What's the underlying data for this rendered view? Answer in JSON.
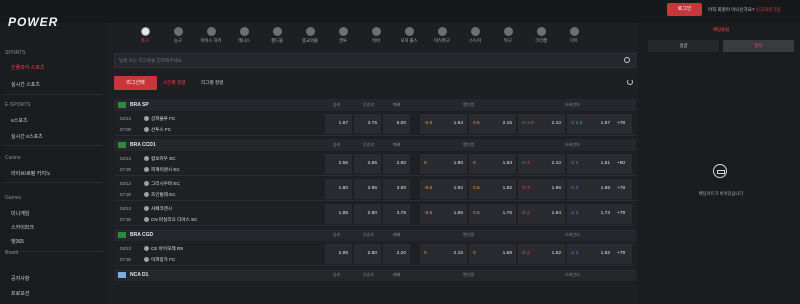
{
  "header": {
    "logo": "POWER",
    "login_label": "로그인",
    "note": "아직 회원이 아니신가요?",
    "signup_link": "신규회원가입"
  },
  "sidebar": {
    "sections": [
      {
        "title": "SPORTS",
        "items": [
          {
            "label": "인플라이 스포츠",
            "active": true
          },
          {
            "label": "실시간 스포츠",
            "active": false
          }
        ]
      },
      {
        "title": "E-SPORTS",
        "items": [
          {
            "label": "e스포츠",
            "active": false
          },
          {
            "label": "실시간 e스포츠",
            "active": false
          }
        ]
      },
      {
        "title": "Casino",
        "items": [
          {
            "label": "라이브/로펌 카지노",
            "active": false
          }
        ]
      },
      {
        "title": "Games",
        "items": [
          {
            "label": "미니게임",
            "active": false
          },
          {
            "label": "스카이파크",
            "active": false
          },
          {
            "label": "벳365",
            "active": false
          }
        ]
      },
      {
        "title": "Board",
        "items": [
          {
            "label": "공지사항",
            "active": false
          },
          {
            "label": "프로모션",
            "active": false
          }
        ]
      }
    ]
  },
  "sports": [
    {
      "label": "축구",
      "active": true
    },
    {
      "label": "농구",
      "active": false
    },
    {
      "label": "아이스 하키",
      "active": false
    },
    {
      "label": "테니스",
      "active": false
    },
    {
      "label": "핸드볼",
      "active": false
    },
    {
      "label": "종교의볼",
      "active": false
    },
    {
      "label": "권투",
      "active": false
    },
    {
      "label": "럭비",
      "active": false
    },
    {
      "label": "오지 룰스",
      "active": false
    },
    {
      "label": "미식축구",
      "active": false
    },
    {
      "label": "스누커",
      "active": false
    },
    {
      "label": "탁구",
      "active": false
    },
    {
      "label": "크리켓",
      "active": false
    },
    {
      "label": "다트",
      "active": false
    }
  ],
  "search": {
    "placeholder": "팀명 또는 리그명을 입력해주세요."
  },
  "controls": {
    "league_select": "리그선택",
    "sort_time": "시간별 정렬",
    "sort_league": "리그별 정렬"
  },
  "columns": {
    "win": "승리",
    "draw": "무승부",
    "lose": "패배",
    "handicap": "핸디캡",
    "overunder": "오버언더"
  },
  "leagues": [
    {
      "name": "BRA SP",
      "matches": [
        {
          "date": "02/13",
          "time": "07:00",
          "home": "상파울루 FC",
          "away": "산투스 FC",
          "win": "1.67",
          "draw": "3.75",
          "lose": "5.00",
          "h1_line": "-0.5",
          "h1_odd": "1.64",
          "h2_line": "0.5",
          "h2_odd": "2.15",
          "ou_over_line": "O 2.5",
          "ou_over_odd": "2.10",
          "ou_under_line": "U 2.5",
          "ou_under_odd": "1.67",
          "more": "+78"
        }
      ]
    },
    {
      "name": "BRA CCD1",
      "matches": [
        {
          "date": "02/13",
          "time": "07:30",
          "home": "컴보카우 SC",
          "away": "피계이렌시 EC",
          "win": "2.55",
          "draw": "2.65",
          "lose": "2.60",
          "h1_line": "0",
          "h1_odd": "1.80",
          "h2_line": "0",
          "h2_odd": "1.83",
          "ou_over_line": "O 2",
          "ou_over_odd": "2.10",
          "ou_under_line": "U 2",
          "ou_under_odd": "1.61",
          "more": "+80"
        },
        {
          "date": "02/13",
          "time": "07:30",
          "home": "그리시우마 EC",
          "away": "조인빌레 EC",
          "win": "1.80",
          "draw": "2.95",
          "lose": "3.90",
          "h1_line": "-0.5",
          "h1_odd": "1.82",
          "h2_line": "0.5",
          "h2_odd": "1.82",
          "ou_over_line": "O 2",
          "ou_over_odd": "1.96",
          "ou_under_line": "U 2",
          "ou_under_odd": "1.68",
          "more": "+78"
        },
        {
          "date": "02/13",
          "time": "07:30",
          "home": "샤페코엔시",
          "away": "CN 마실리오 디아스 SC",
          "win": "1.85",
          "draw": "2.90",
          "lose": "3.75",
          "h1_line": "-0.5",
          "h1_odd": "1.85",
          "h2_line": "0.5",
          "h2_odd": "1.76",
          "ou_over_line": "O 2",
          "ou_over_odd": "1.94",
          "ou_under_line": "U 2",
          "ou_under_odd": "1.73",
          "more": "+79"
        }
      ]
    },
    {
      "name": "BRA CGD",
      "matches": [
        {
          "date": "02/13",
          "time": "07:30",
          "home": "CE 아이모레 RS",
          "away": "이파랑가 FC",
          "win": "2.95",
          "draw": "2.80",
          "lose": "2.20",
          "h1_line": "0",
          "h1_odd": "2.15",
          "h2_line": "0",
          "h2_odd": "1.58",
          "ou_over_line": "O 2",
          "ou_over_odd": "1.82",
          "ou_under_line": "U 2",
          "ou_under_odd": "1.82",
          "more": "+79"
        }
      ]
    },
    {
      "name": "NCA D1",
      "matches": []
    }
  ],
  "betslip": {
    "title": "배팅슬립",
    "tab_single": "싱글",
    "tab_multi": "멀티",
    "empty": "배팅카트가 비어있습니다"
  }
}
